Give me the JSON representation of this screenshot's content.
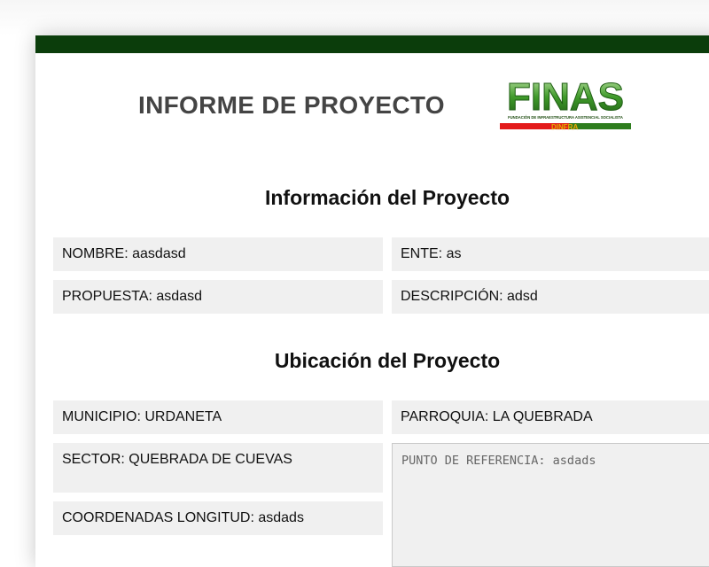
{
  "header": {
    "title": "INFORME DE PROYECTO",
    "bar_color": "#0b3d0b"
  },
  "logo": {
    "wordmark": "FINAS",
    "tagline": "FUNDACIÓN DE INFRAESTRUCTURA ASISTENCIAL SOCIALISTA",
    "sub": "DINFRA",
    "colors": {
      "green": "#2e7d1e",
      "red": "#e31b1b",
      "yellow": "#f2b705"
    }
  },
  "info_section": {
    "title": "Información del Proyecto",
    "nombre": "NOMBRE: aasdasd",
    "ente": "ENTE: as",
    "propuesta": "PROPUESTA: asdasd",
    "descripcion": "DESCRIPCIÓN: adsd"
  },
  "location_section": {
    "title": "Ubicación del Proyecto",
    "municipio": "MUNICIPIO: URDANETA",
    "parroquia": "PARROQUIA: LA QUEBRADA",
    "sector": "SECTOR: QUEBRADA DE CUEVAS",
    "punto_referencia": "PUNTO DE REFERENCIA: asdads",
    "coordenadas_longitud": "COORDENADAS LONGITUD: asdads"
  }
}
